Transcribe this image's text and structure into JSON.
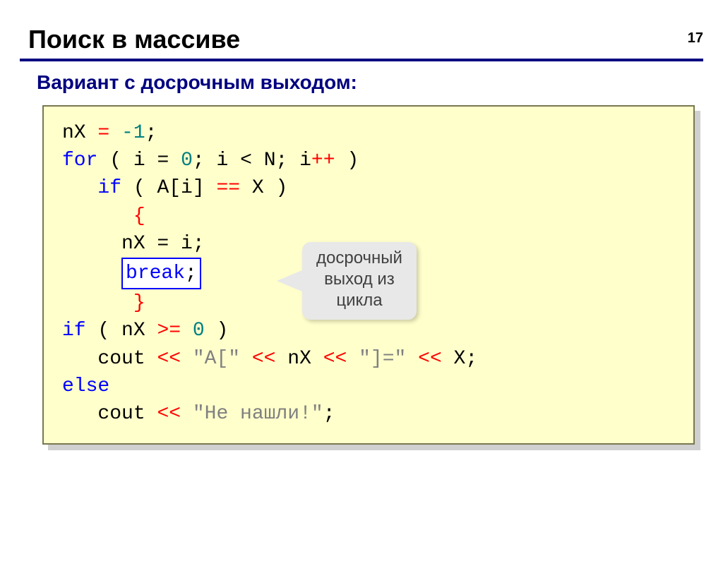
{
  "page_number": "17",
  "title": "Поиск в массиве",
  "subtitle": "Вариант с досрочным выходом:",
  "code": {
    "nX": "nX",
    "assign1": " = ",
    "neg1": "-1",
    "semi": ";",
    "for_kw": "for",
    "paren_open": " ( ",
    "i_eq": "i = ",
    "zero": "0",
    "i_lt_n": "; i < N; i",
    "inc": "++",
    "paren_close": " )",
    "if_kw": "if",
    "cond_open": " ( A[i] ",
    "eqeq": "==",
    "cond_close": " X )",
    "brace_open": "{",
    "nX_i": "nX = i;",
    "break_kw": "break",
    "brace_close": "}",
    "if2_open": " ( nX ",
    "geq": ">=",
    "if2_close": " ",
    "zero2": "0",
    "paren_close2": " )",
    "cout": "cout ",
    "lshift": "<<",
    "str1": " \"A[\" ",
    "str2": " nX ",
    "str3": " \"]=\" ",
    "x_end": " X;",
    "else_kw": "else",
    "str4": " \"Не нашли!\"",
    "semi_end": ";"
  },
  "annotation": {
    "line1": "досрочный",
    "line2": "выход из",
    "line3": "цикла"
  }
}
